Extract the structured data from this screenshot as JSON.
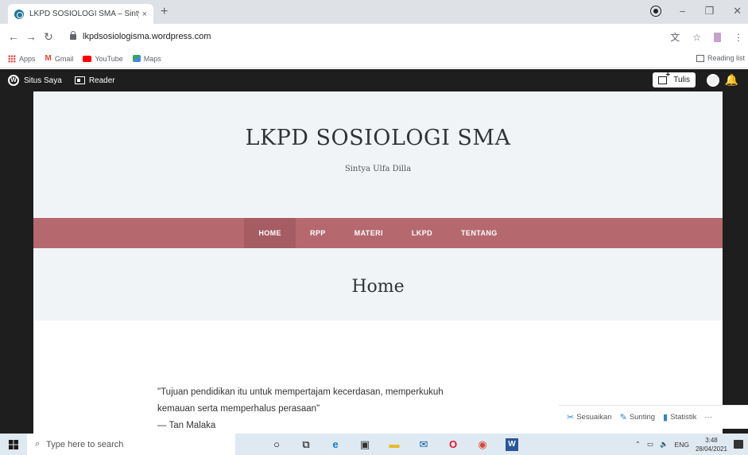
{
  "browser": {
    "tab_title": "LKPD SOSIOLOGI SMA – Sintya U",
    "tab_close": "×",
    "new_tab": "+",
    "url": "lkpdsosiologisma.wordpress.com",
    "window_controls": {
      "minimize": "−",
      "restore": "❐",
      "close": "✕"
    },
    "nav": {
      "back": "←",
      "forward": "→",
      "reload": "↻"
    },
    "bookmarks": [
      {
        "label": "Apps",
        "icon": "apps-grid-icon",
        "color": "#e8453c"
      },
      {
        "label": "Gmail",
        "icon": "gmail-icon",
        "color": "#ea4335"
      },
      {
        "label": "YouTube",
        "icon": "youtube-icon",
        "color": "#ff0000"
      },
      {
        "label": "Maps",
        "icon": "maps-icon",
        "color": "#34a853"
      }
    ],
    "reading_list": "Reading list"
  },
  "wp_admin_bar": {
    "my_site": "Situs Saya",
    "reader": "Reader",
    "write": "Tulis"
  },
  "site": {
    "title": "LKPD SOSIOLOGI SMA",
    "tagline": "Sintya Ulfa Dilla",
    "menu": [
      "HOME",
      "RPP",
      "MATERI",
      "LKPD",
      "TENTANG"
    ],
    "active_menu": "HOME",
    "menu_color": "#b5696f",
    "page_heading": "Home",
    "quote_line1": "\"Tujuan pendidikan itu untuk mempertajam kecerdasan, memperkukuh",
    "quote_line2": "kemauan serta memperhalus perasaan\"",
    "quote_author": "— Tan Malaka"
  },
  "wp_actions": {
    "customize": "Sesuaikan",
    "edit": "Sunting",
    "stats": "Statistik",
    "more": "···"
  },
  "taskbar": {
    "search_placeholder": "Type here to search",
    "language": "ENG",
    "time": "3:48",
    "date": "28/04/2021"
  }
}
